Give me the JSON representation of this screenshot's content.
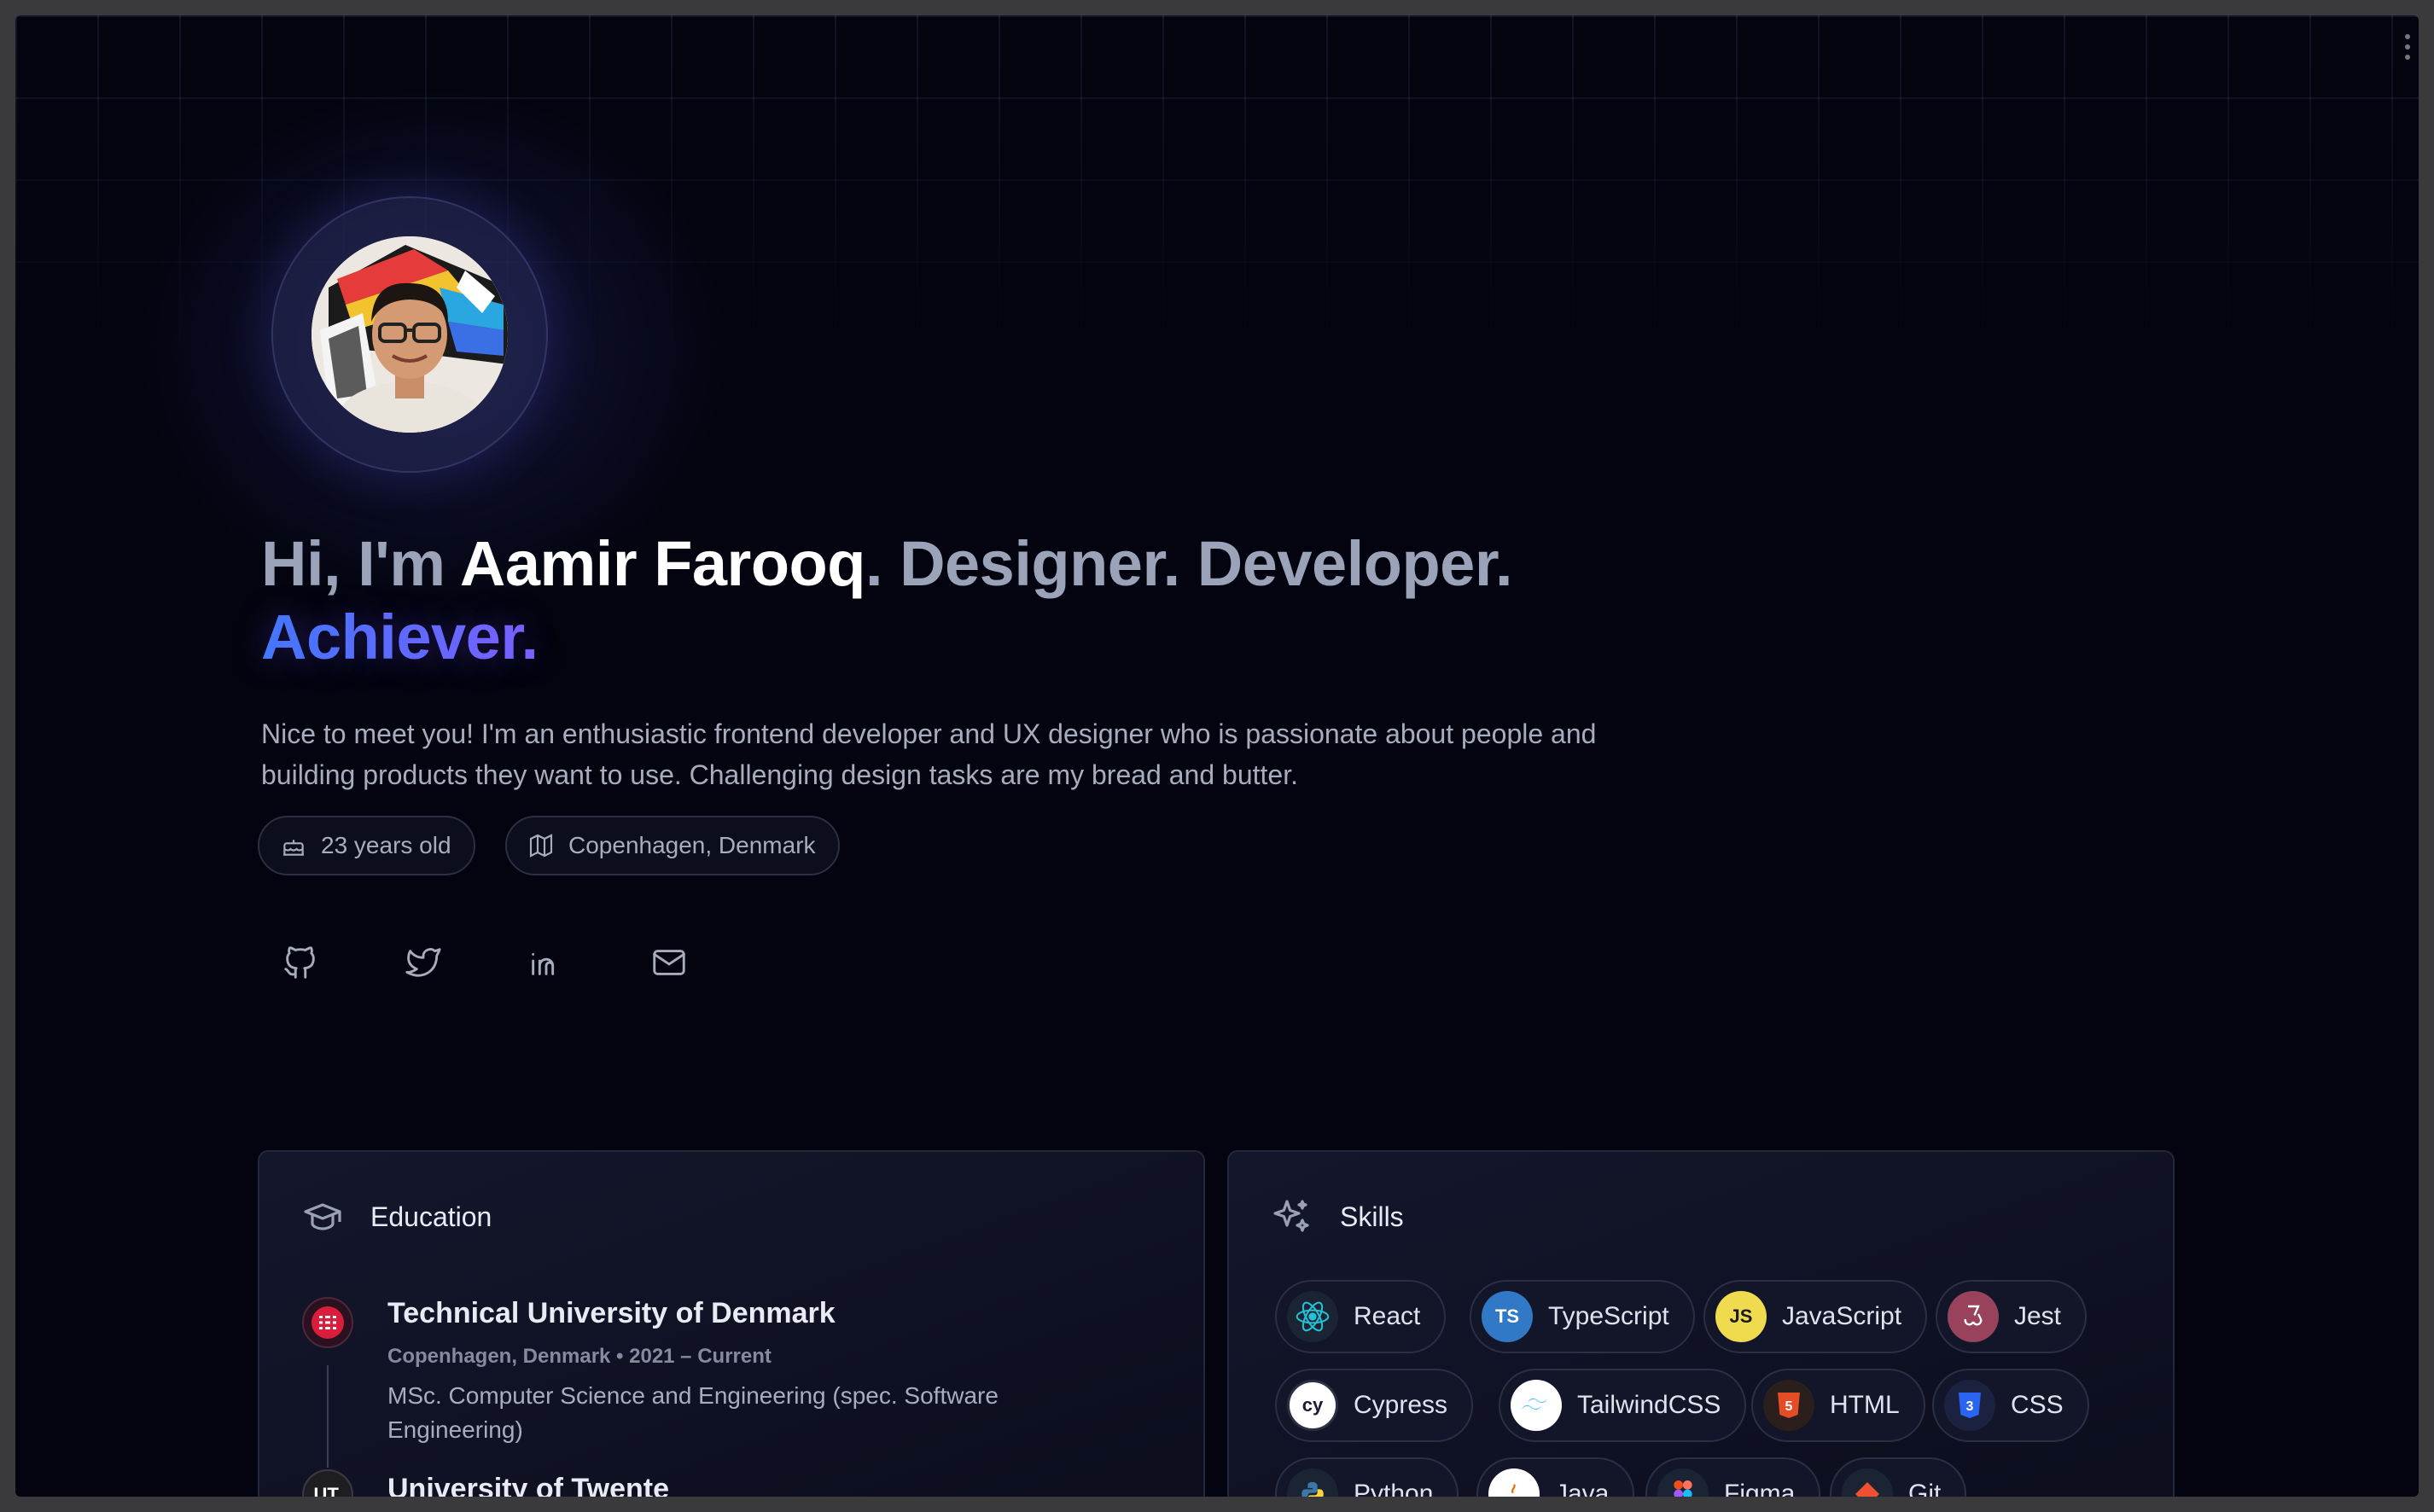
{
  "profile": {
    "greeting": "Hi, I'm ",
    "name": "Aamir Farooq",
    "tagline_after_name": ". Designer. Developer.",
    "highlight": "Achiever.",
    "intro": "Nice to meet you! I'm an enthusiastic frontend developer and UX designer who is passionate about people and building products they want to use. Challenging design tasks are my bread and butter.",
    "age_chip": "23 years old",
    "location_chip": "Copenhagen, Denmark"
  },
  "social": [
    {
      "icon": "github-icon"
    },
    {
      "icon": "twitter-icon"
    },
    {
      "icon": "linkedin-icon"
    },
    {
      "icon": "mail-icon"
    }
  ],
  "education": {
    "title": "Education",
    "items": [
      {
        "name": "Technical University of Denmark",
        "meta": "Copenhagen, Denmark • 2021 – Current",
        "desc": "MSc. Computer Science and Engineering (spec. Software Engineering)",
        "logo_color": "#d81e3a"
      },
      {
        "name": "University of Twente",
        "logo_text": "UT.",
        "logo_color": "#2a2a2e"
      }
    ]
  },
  "skills": {
    "title": "Skills",
    "items": [
      {
        "label": "React",
        "icon": "react-icon",
        "color": "#1b2433"
      },
      {
        "label": "TypeScript",
        "icon": "typescript-icon",
        "badge": "TS",
        "color": "#3178c6"
      },
      {
        "label": "JavaScript",
        "icon": "javascript-icon",
        "badge": "JS",
        "color": "#f0db4f"
      },
      {
        "label": "Jest",
        "icon": "jest-icon",
        "color": "#99425b"
      },
      {
        "label": "Cypress",
        "icon": "cypress-icon",
        "badge": "cy",
        "color": "#ffffff"
      },
      {
        "label": "TailwindCSS",
        "icon": "tailwind-icon",
        "color": "#ffffff"
      },
      {
        "label": "HTML",
        "icon": "html-icon",
        "badge": "5",
        "color": "#2b1f1c"
      },
      {
        "label": "CSS",
        "icon": "css-icon",
        "badge": "3",
        "color": "#1b2240"
      },
      {
        "label": "Python",
        "icon": "python-icon",
        "color": "#1b2433"
      },
      {
        "label": "Java",
        "icon": "java-icon",
        "color": "#ffffff"
      },
      {
        "label": "Figma",
        "icon": "figma-icon",
        "color": "#1b2433"
      },
      {
        "label": "Git",
        "icon": "git-icon",
        "color": "#1b2433"
      }
    ]
  }
}
